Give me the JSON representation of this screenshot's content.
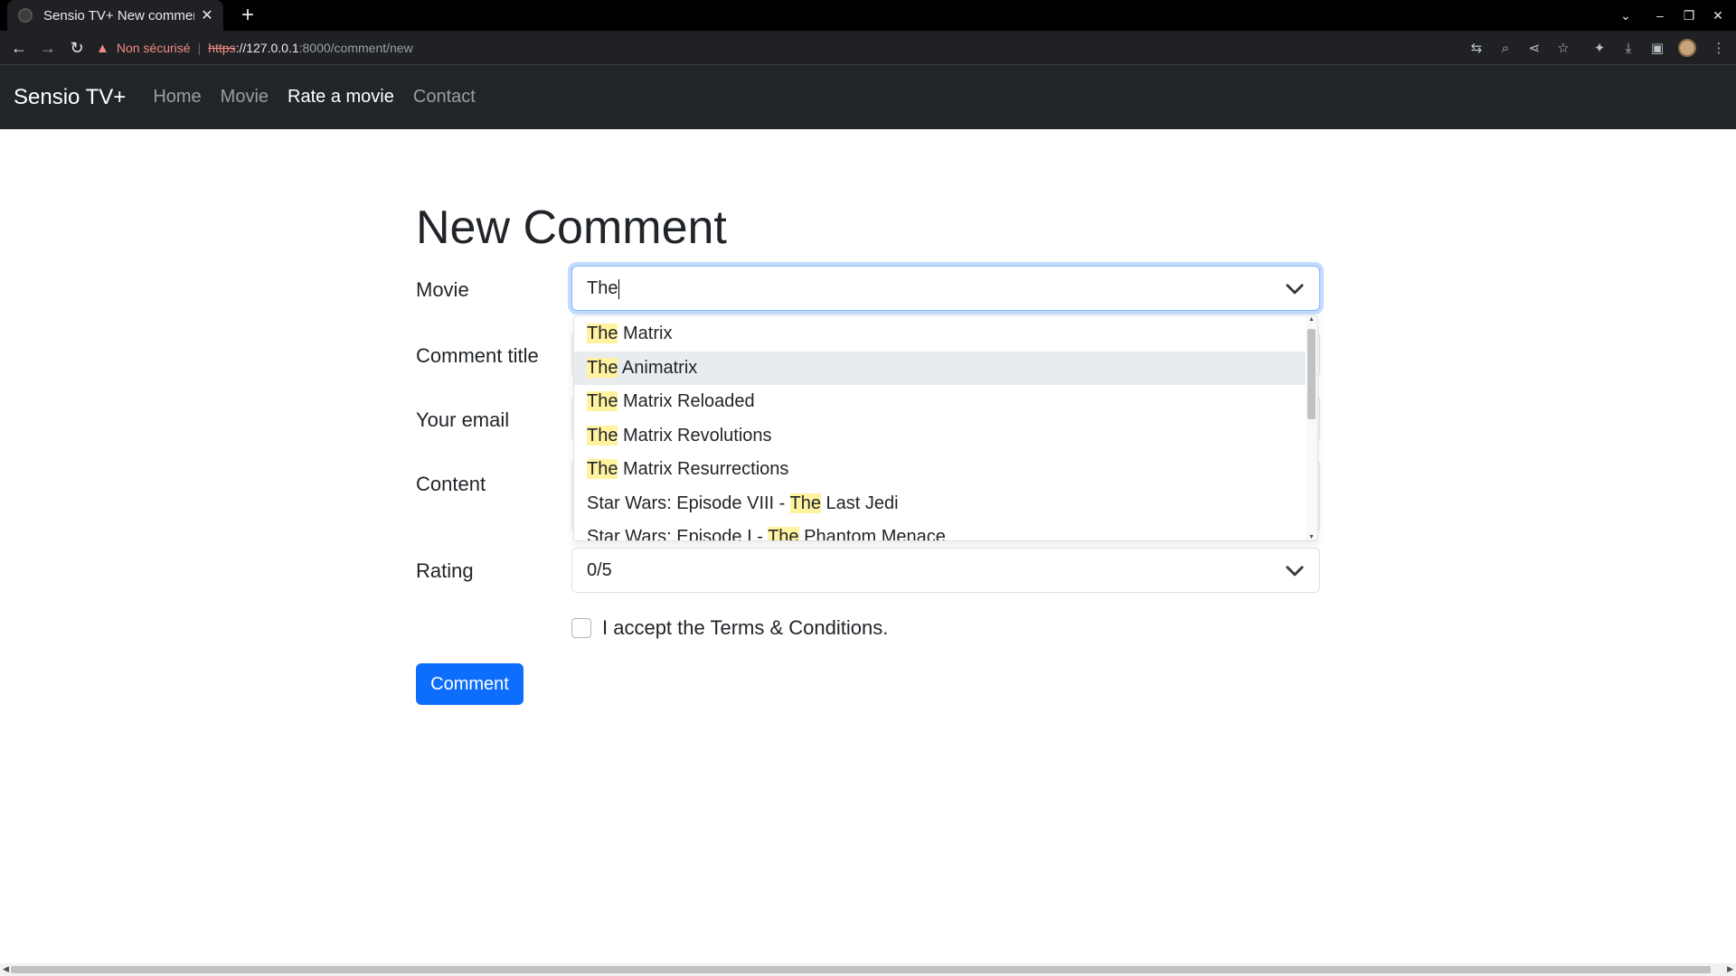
{
  "browser": {
    "tab_title": "Sensio TV+ New comment",
    "security_label": "Non sécurisé",
    "url_scheme": "https",
    "url_host": "://127.0.0.1",
    "url_rest": ":8000/comment/new"
  },
  "navbar": {
    "brand": "Sensio TV+",
    "links": [
      "Home",
      "Movie",
      "Rate a movie",
      "Contact"
    ],
    "active_link": "Rate a movie"
  },
  "form": {
    "title": "New Comment",
    "movie_label": "Movie",
    "movie_value": "The",
    "comment_title_label": "Comment title",
    "email_label": "Your email",
    "content_label": "Content",
    "rating_label": "Rating",
    "rating_value": "0/5",
    "terms_label": "I accept the Terms & Conditions.",
    "submit_label": "Comment"
  },
  "dropdown": {
    "highlighted_index": 1,
    "options": [
      {
        "pre": "",
        "match": "The",
        "post": " Matrix"
      },
      {
        "pre": "",
        "match": "The",
        "post": " Animatrix"
      },
      {
        "pre": "",
        "match": "The",
        "post": " Matrix Reloaded"
      },
      {
        "pre": "",
        "match": "The",
        "post": " Matrix Revolutions"
      },
      {
        "pre": "",
        "match": "The",
        "post": " Matrix Resurrections"
      },
      {
        "pre": "Star Wars: Episode VIII - ",
        "match": "The",
        "post": " Last Jedi"
      },
      {
        "pre": "Star Wars: Episode I - ",
        "match": "The",
        "post": " Phantom Menace"
      }
    ]
  },
  "icons": {
    "tab_favicon": "globe-icon",
    "tab_close": "close-icon",
    "new_tab": "plus-icon",
    "back": "back-arrow-icon",
    "forward": "forward-arrow-icon",
    "reload": "reload-icon",
    "warning": "warning-icon",
    "translate": "translate-icon",
    "zoom": "zoom-icon",
    "share": "share-icon",
    "bookmark": "star-icon",
    "extensions": "puzzle-icon",
    "download": "download-icon",
    "sidepanel": "side-panel-icon",
    "menu": "kebab-menu-icon",
    "dropdown_chevron": "chevron-down-icon"
  },
  "colors": {
    "primary": "#0d6efd",
    "navbar_bg": "#212529",
    "match_highlight": "#fff3a0",
    "focus_ring": "#86b7fe"
  }
}
